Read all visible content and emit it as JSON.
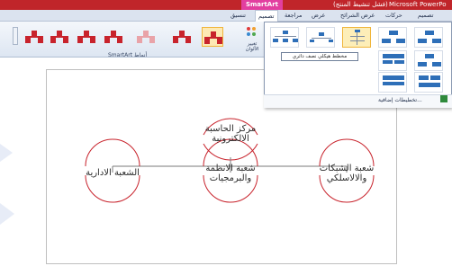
{
  "window": {
    "context_tab": "SmartArt أدوات",
    "document_title": "(فشل تنشيط المنتج)",
    "app_title": "Microsoft PowerPo"
  },
  "tabs": {
    "format": "تنسيق",
    "design": "تصميم",
    "review": "مراجعة",
    "view": "عرض",
    "slideshow": "عرض الشرائح",
    "animations": "حركات",
    "design_main": "تصميم"
  },
  "ribbon": {
    "styles_group_label": "SmartArt أنماط",
    "change_colors_label": "تغيير الألوان"
  },
  "layout_dropdown": {
    "tooltip": "مخطط هيكلي نصف دائري",
    "more_layouts": "تخطيطات إضافية..."
  },
  "diagram": {
    "root": "مركز الحاسبة\nالالكترونية",
    "children": [
      "شعبة الشبكات\nوالالاسلكي",
      "شعبة الانظمة\nوالبرمجيات",
      "الشعبة الادارية"
    ]
  },
  "colors": {
    "title_bar": "#c0252a",
    "context_tab": "#e23fa0",
    "accent_red": "#c8232c",
    "arc_red": "#c8232c",
    "selection": "#f0b53a"
  }
}
